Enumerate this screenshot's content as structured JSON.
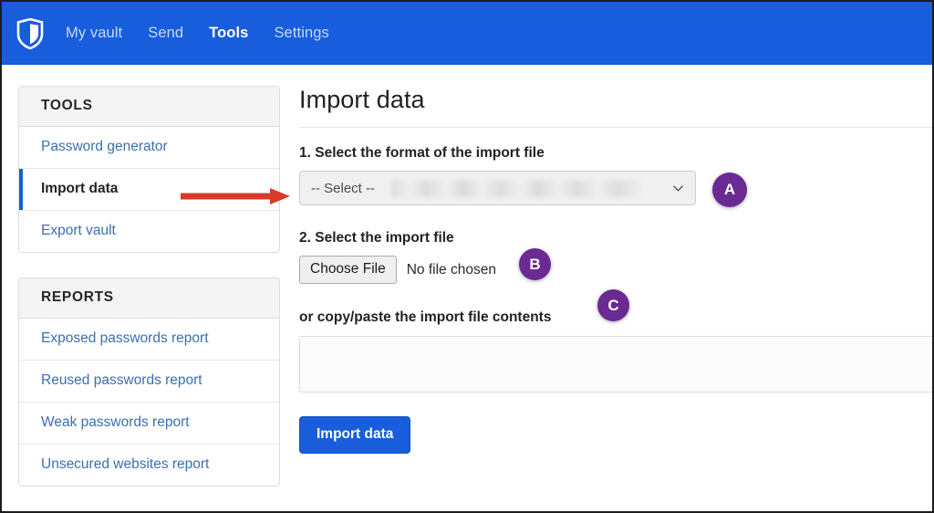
{
  "app": {
    "logo_icon": "bitwarden-shield-icon",
    "brand_blue": "#175ddc",
    "annotation_purple": "#6a2a92",
    "annotation_red": "#d93b2b"
  },
  "topnav": {
    "items": [
      {
        "label": "My vault",
        "active": false
      },
      {
        "label": "Send",
        "active": false
      },
      {
        "label": "Tools",
        "active": true
      },
      {
        "label": "Settings",
        "active": false
      }
    ]
  },
  "sidebar": {
    "groups": [
      {
        "title": "TOOLS",
        "items": [
          {
            "label": "Password generator",
            "active": false
          },
          {
            "label": "Import data",
            "active": true
          },
          {
            "label": "Export vault",
            "active": false
          }
        ]
      },
      {
        "title": "REPORTS",
        "items": [
          {
            "label": "Exposed passwords report",
            "active": false
          },
          {
            "label": "Reused passwords report",
            "active": false
          },
          {
            "label": "Weak passwords report",
            "active": false
          },
          {
            "label": "Unsecured websites report",
            "active": false
          }
        ]
      }
    ]
  },
  "main": {
    "page_title": "Import data",
    "step1_label": "1. Select the format of the import file",
    "format_select": {
      "value": "-- Select --",
      "chevron_icon": "chevron-down-icon"
    },
    "step2_label": "2. Select the import file",
    "file_input": {
      "button_label": "Choose File",
      "status_text": "No file chosen"
    },
    "paste_label": "or copy/paste the import file contents",
    "textarea": {
      "value": "",
      "placeholder": ""
    },
    "submit_button_label": "Import data"
  },
  "annotations": {
    "badges": [
      {
        "label": "A",
        "target": "format-select"
      },
      {
        "label": "B",
        "target": "file-input"
      },
      {
        "label": "C",
        "target": "paste-textarea"
      }
    ],
    "arrow": {
      "name": "red-arrow",
      "points_to": "Import data"
    }
  }
}
